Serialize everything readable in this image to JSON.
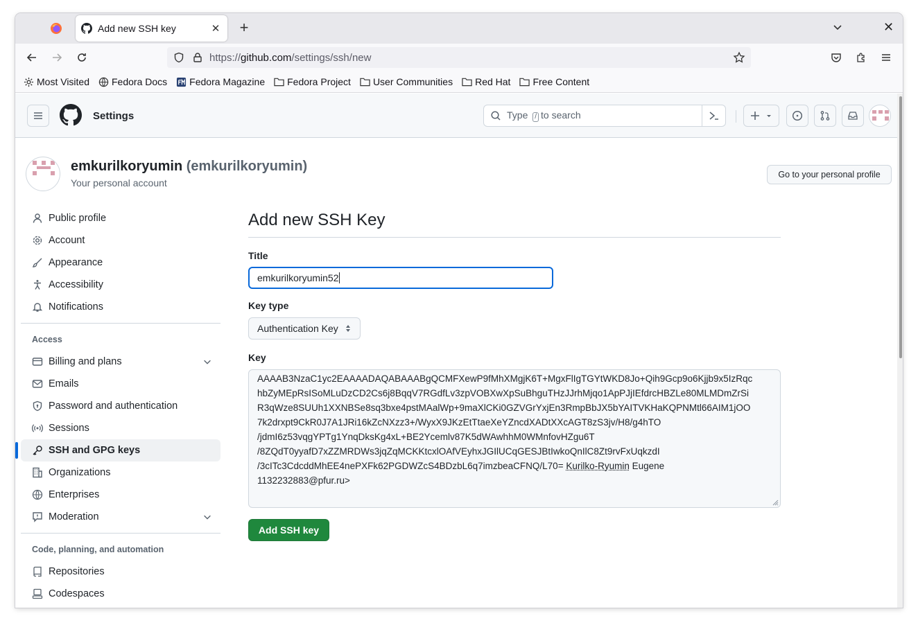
{
  "browser": {
    "tab_title": "Add new SSH key",
    "url_prefix": "https://",
    "url_domain": "github.com",
    "url_path": "/settings/ssh/new",
    "bookmarks": [
      "Most Visited",
      "Fedora Docs",
      "Fedora Magazine",
      "Fedora Project",
      "User Communities",
      "Red Hat",
      "Free Content"
    ]
  },
  "header": {
    "title": "Settings",
    "search_type": "Type",
    "search_key": "/",
    "search_rest": "to search"
  },
  "account": {
    "name": "emkurilkoryumin",
    "login": "(emkurilkoryumin)",
    "subtitle": "Your personal account",
    "profile_button": "Go to your personal profile"
  },
  "sidebar": {
    "items": [
      "Public profile",
      "Account",
      "Appearance",
      "Accessibility",
      "Notifications"
    ],
    "access_heading": "Access",
    "access_items": [
      "Billing and plans",
      "Emails",
      "Password and authentication",
      "Sessions",
      "SSH and GPG keys",
      "Organizations",
      "Enterprises",
      "Moderation"
    ],
    "code_heading": "Code, planning, and automation",
    "code_items": [
      "Repositories",
      "Codespaces"
    ]
  },
  "form": {
    "heading": "Add new SSH Key",
    "title_label": "Title",
    "title_value": "emkurilkoryumin52",
    "keytype_label": "Key type",
    "keytype_value": "Authentication Key",
    "key_label": "Key",
    "key_lines": [
      "AAAAB3NzaC1yc2EAAAADAQABAAABgQCMFXewP9fMhXMgjK6T+MgxFlIgTGYtWKD8Jo+Qih9Gcp9o6Kjjb9x5IzRqc",
      "hbZyMEpRsISoMLuDzCD2Cs6j8BqqV7RGdfLv3zpVOBXwXpSuBhguTHzJJrhMjqo1ApPJjIEfdrcHBZLe80MLMDmZrSi",
      "R3qWze8SUUh1XXNBSe8sq3bxe4pstMAalWp+9maXlCKi0GZVGrYxjEn3RmpBbJX5bYAITVKHaKQPNMtl66AIM1jOO",
      "7k2drxpt9CkR0J7A1JRi16kZcNXzz3+/WyxX9JKzEtTtaeXeYZncdXADtXXcAGT8zS3jv/H8/g4hTO",
      "/jdmI6z53vqgYPTg1YnqDksKg4xL+BE2Ycemlv87K5dWAwhhM0WMnfovHZgu6T",
      "/8ZQdT0yyafD7xZZMRDWs3jqZqMCKKtcxlOAfVEyhxJGIlUCqGESJBtIwkoQnIlC8Zt9rvFxUqkzdI",
      "/3cITc3CdcddMhEE4nePXFk62PGDWZcS4BDzbL6q7imzbeaCFNQ/L70="
    ],
    "key_last_name_a": "Kurilko-Ryumin",
    "key_last_name_b": "Eugene",
    "key_email_line": "1132232883@pfur.ru>",
    "submit_label": "Add SSH key"
  },
  "colors": {
    "accent": "#0969da",
    "submit_green": "#1f883d",
    "avatar_pink": "#d9a0ae"
  }
}
